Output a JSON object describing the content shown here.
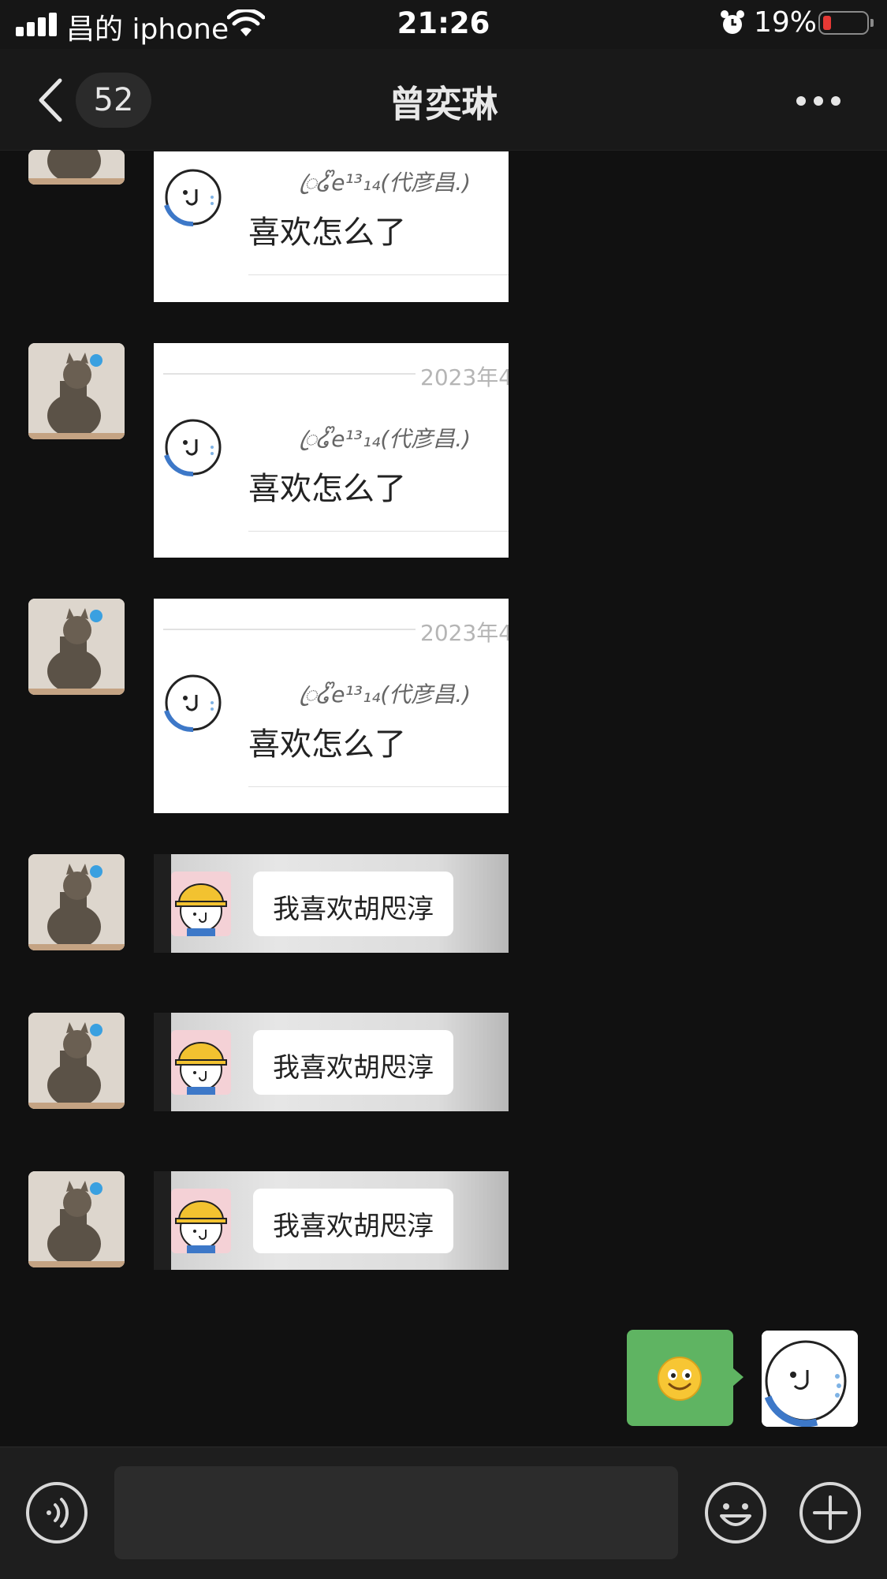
{
  "status_bar": {
    "carrier": "昌的 iphone",
    "time": "21:26",
    "battery_percent": "19%",
    "battery_level": 0.19,
    "battery_color": "#e53935"
  },
  "nav": {
    "unread_count": "52",
    "title": "曾奕琳",
    "back_icon": "chevron-left-icon",
    "more_icon": "ellipsis-icon"
  },
  "messages": [
    {
      "type": "sticker",
      "variant": "quote",
      "sender": "ꦿ໒ᩚe¹³₁₄(代彦昌.)",
      "text": "喜欢怎么了",
      "date": ""
    },
    {
      "type": "sticker",
      "variant": "quote",
      "sender": "ꦿ໒ᩚe¹³₁₄(代彦昌.)",
      "text": "喜欢怎么了",
      "date": "2023年4"
    },
    {
      "type": "sticker",
      "variant": "quote",
      "sender": "ꦿ໒ᩚe¹³₁₄(代彦昌.)",
      "text": "喜欢怎么了",
      "date": "2023年4"
    },
    {
      "type": "sticker",
      "variant": "bubble",
      "text": "我喜欢胡咫淳"
    },
    {
      "type": "sticker",
      "variant": "bubble",
      "text": "我喜欢胡咫淳"
    },
    {
      "type": "sticker",
      "variant": "bubble",
      "text": "我喜欢胡咫淳"
    }
  ],
  "outgoing": {
    "emoji_icon": "smiley-emoji-icon",
    "bubble_color": "#5fb462"
  },
  "input_bar": {
    "voice_icon": "voice-icon",
    "emoji_icon": "emoji-face-icon",
    "plus_icon": "plus-circle-icon",
    "input_value": ""
  }
}
